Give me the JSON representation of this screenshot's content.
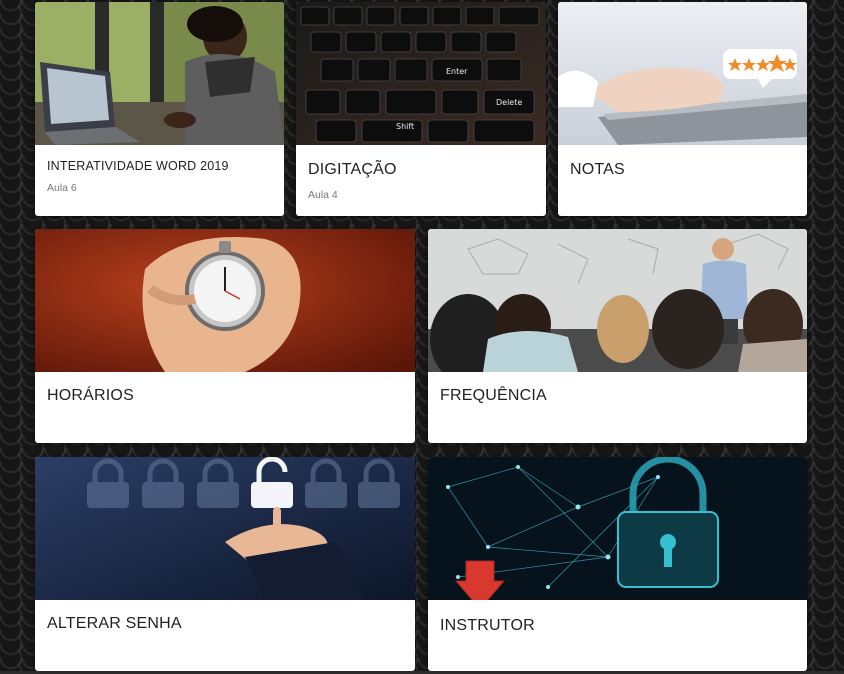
{
  "cards": [
    {
      "title": "INTERATIVIDADE WORD 2019",
      "subtitle": "Aula 6",
      "image": "woman-at-laptop-photo"
    },
    {
      "title": "DIGITAÇÃO",
      "subtitle": "Aula 4",
      "image": "keyboard-closeup-photo"
    },
    {
      "title": "NOTAS",
      "subtitle": "",
      "image": "typing-with-rating-bubble-photo"
    },
    {
      "title": "HORÁRIOS",
      "image": "stopwatch-in-hand-photo"
    },
    {
      "title": "FREQUÊNCIA",
      "image": "classroom-teacher-photo"
    },
    {
      "title": "ALTERAR SENHA",
      "image": "padlocks-touch-photo"
    },
    {
      "title": "INSTRUTOR",
      "image": "digital-padlock-network-photo"
    }
  ],
  "colors": {
    "card_bg": "#ffffff",
    "page_bg": "#161616",
    "arrow": "#d9382f",
    "star": "#f28c28"
  }
}
